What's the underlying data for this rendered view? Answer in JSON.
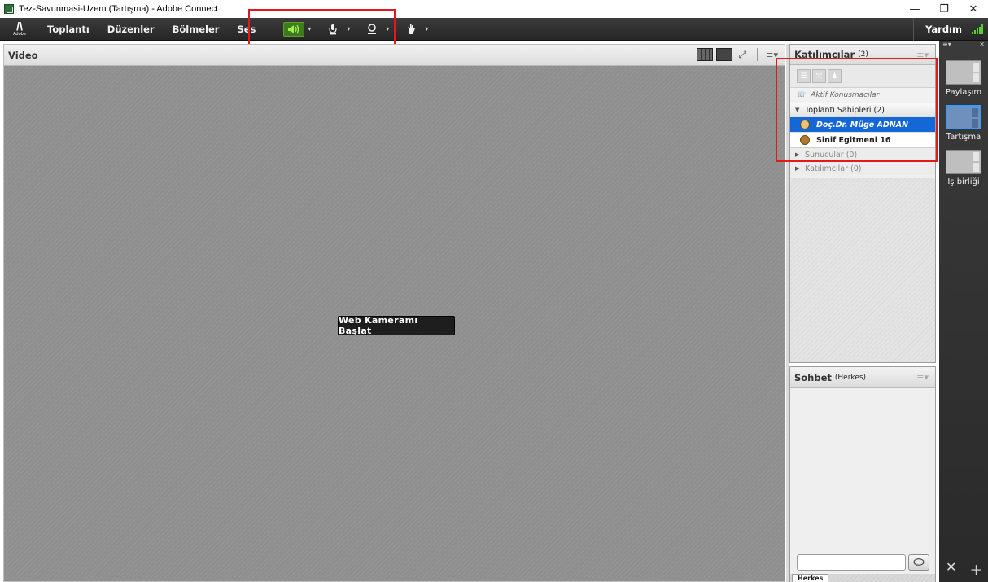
{
  "window": {
    "title": "Tez-Savunmasi-Uzem (Tartışma) - Adobe Connect",
    "minimize": "—",
    "restore": "❐",
    "close": "✕"
  },
  "menubar": {
    "logo_text": "Adobe",
    "items": [
      "Toplantı",
      "Düzenler",
      "Bölmeler",
      "Ses"
    ],
    "help": "Yardım",
    "dropdown_glyph": "▾"
  },
  "video_pod": {
    "title": "Video",
    "start_webcam": "Web Kameramı Başlat"
  },
  "attendees_pod": {
    "title": "Katılımcılar",
    "count": "(2)",
    "active_speakers": "Aktif Konuşmacılar",
    "groups": [
      {
        "label": "Toplantı Sahipleri (2)",
        "expanded": true
      },
      {
        "label": "Sunucular (0)",
        "expanded": false
      },
      {
        "label": "Katılımcılar (0)",
        "expanded": false
      }
    ],
    "hosts": [
      {
        "name": "Doç.Dr. Müge ADNAN",
        "selected": true
      },
      {
        "name": "Sinif Egitmeni 16",
        "selected": false
      }
    ]
  },
  "chat_pod": {
    "title": "Sohbet",
    "scope": "(Herkes)",
    "input_value": "",
    "tab_label": "Herkes"
  },
  "layouts": {
    "items": [
      {
        "label": "Paylaşım",
        "active": false
      },
      {
        "label": "Tartışma",
        "active": true
      },
      {
        "label": "İş birliği",
        "active": false
      }
    ]
  },
  "colors": {
    "selected_row": "#1467d6",
    "highlight_box": "#e31818",
    "audio_active": "#3f7a1f",
    "signal": "#56d12a"
  },
  "icons": {
    "speaker": "speaker-icon",
    "microphone": "microphone-icon",
    "webcam": "webcam-icon",
    "raise_hand": "raise-hand-icon",
    "chat_send": "speech-bubble-icon"
  }
}
